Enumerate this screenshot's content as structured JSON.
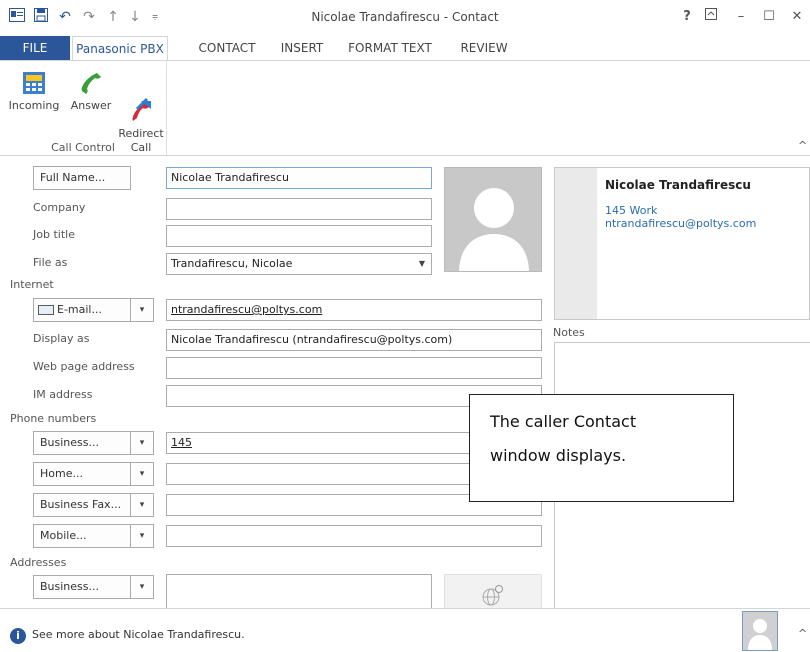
{
  "window": {
    "title": "Nicolae Trandafirescu - Contact",
    "help": "?",
    "restore": "⊼",
    "minimize": "–",
    "maximize": "☐",
    "close": "✕"
  },
  "qat": {
    "undo": "↶",
    "redo": "↷",
    "up": "↑",
    "down": "↓",
    "more": "⩦"
  },
  "tabs": [
    "FILE",
    "Panasonic PBX",
    "CONTACT",
    "INSERT",
    "FORMAT TEXT",
    "REVIEW"
  ],
  "ribbon": {
    "buttons": [
      {
        "label": "Incoming",
        "icon": "incoming-call-icon"
      },
      {
        "label": "Answer",
        "icon": "answer-phone-icon"
      },
      {
        "label": "Redirect\nCall",
        "icon": "redirect-call-icon"
      }
    ],
    "group_label": "Call Control",
    "collapse": "^"
  },
  "form": {
    "full_name_button": "Full Name...",
    "full_name_value": "Nicolae Trandafirescu",
    "company_label": "Company",
    "company_value": "",
    "job_title_label": "Job title",
    "job_title_value": "",
    "file_as_label": "File as",
    "file_as_value": "Trandafirescu, Nicolae",
    "internet_section": "Internet",
    "email_button": "E-mail...",
    "email_value": "ntrandafirescu@poltys.com",
    "display_as_label": "Display as",
    "display_as_value": "Nicolae Trandafirescu (ntrandafirescu@poltys.com)",
    "web_label": "Web page address",
    "im_label": "IM address",
    "phone_section": "Phone numbers",
    "phones": [
      {
        "label": "Business...",
        "value": "145"
      },
      {
        "label": "Home...",
        "value": ""
      },
      {
        "label": "Business Fax...",
        "value": ""
      },
      {
        "label": "Mobile...",
        "value": ""
      }
    ],
    "addresses_section": "Addresses",
    "address_button": "Business..."
  },
  "card": {
    "name": "Nicolae Trandafirescu",
    "phone": "145 Work",
    "email": "ntrandafirescu@poltys.com"
  },
  "notes_label": "Notes",
  "callout": {
    "line1": "The caller Contact",
    "line2": "window displays."
  },
  "footer": {
    "text": "See more about Nicolae Trandafirescu."
  },
  "colors": {
    "accent": "#2b579a",
    "link": "#2b6cb0"
  }
}
